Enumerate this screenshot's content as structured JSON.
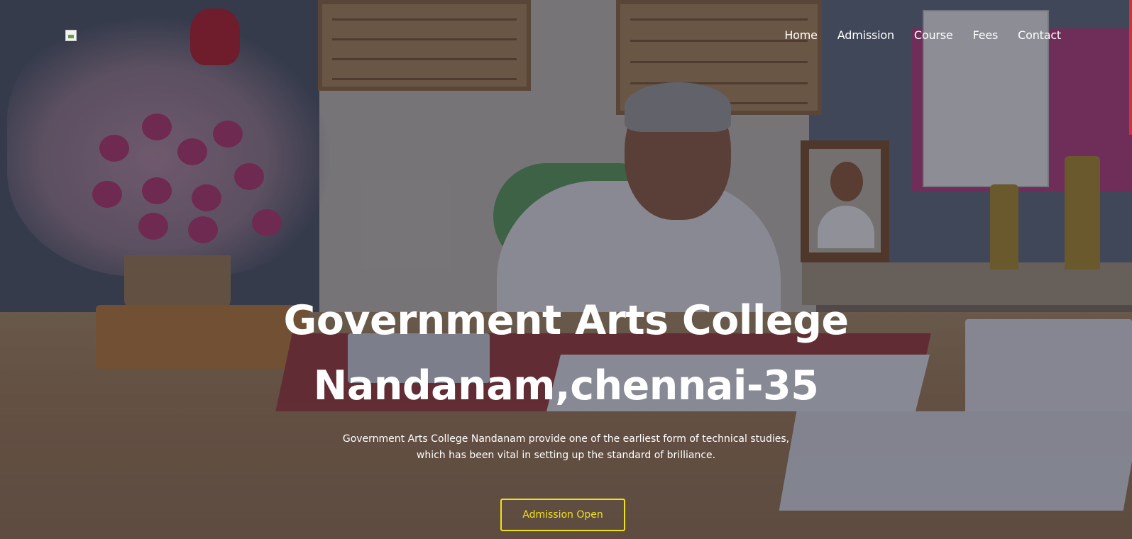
{
  "header": {
    "logo_alt": "",
    "nav": [
      {
        "label": "Home"
      },
      {
        "label": "Admission"
      },
      {
        "label": "Course"
      },
      {
        "label": "Fees"
      },
      {
        "label": "Contact"
      }
    ]
  },
  "hero": {
    "title_line1": "Government Arts College",
    "title_line2": "Nandanam,chennai-35",
    "subtitle_line1": "Government Arts College Nandanam provide one of the earliest form of technical studies,",
    "subtitle_line2": "which has been vital in setting up the standard of brilliance.",
    "cta_label": "Admission Open"
  },
  "colors": {
    "accent": "#f0e21a",
    "text": "#ffffff"
  }
}
